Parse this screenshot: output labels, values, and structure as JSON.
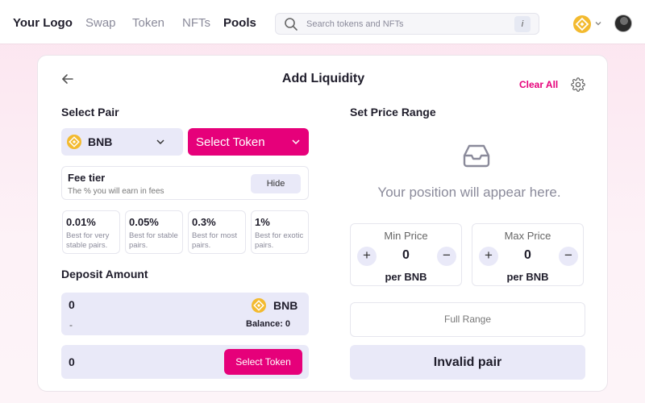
{
  "nav": {
    "logo": "Your Logo",
    "links": [
      {
        "label": "Swap",
        "active": false
      },
      {
        "label": "Token",
        "active": false
      },
      {
        "label": "NFTs",
        "active": false
      },
      {
        "label": "Pools",
        "active": true
      }
    ],
    "search_placeholder": "Search tokens and NFTs",
    "search_info": "i",
    "chain_icon": "bnb-coin-icon",
    "avatar_icon": "avatar"
  },
  "card": {
    "title": "Add Liquidity",
    "clear_all": "Clear All",
    "select_pair_label": "Select Pair",
    "token_a": "BNB",
    "select_token_label": "Select Token",
    "fee": {
      "title": "Fee tier",
      "subtitle": "The % you will earn in fees",
      "hide_label": "Hide",
      "tiers": [
        {
          "pct": "0.01%",
          "desc": "Best for very stable pairs."
        },
        {
          "pct": "0.05%",
          "desc": "Best for stable pairs."
        },
        {
          "pct": "0.3%",
          "desc": "Best for most pairs."
        },
        {
          "pct": "1%",
          "desc": "Best for exotic pairs."
        }
      ]
    },
    "deposit": {
      "label": "Deposit Amount",
      "first": {
        "amount": "0",
        "usd": "-",
        "token": "BNB",
        "balance": "Balance: 0"
      },
      "second": {
        "amount": "0",
        "select_label": "Select Token"
      }
    },
    "price_range": {
      "label": "Set Price Range",
      "empty_text": "Your position will appear here.",
      "min": {
        "label": "Min Price",
        "value": "0",
        "unit": "per BNB"
      },
      "max": {
        "label": "Max Price",
        "value": "0",
        "unit": "per BNB"
      },
      "full_range": "Full Range",
      "action": "Invalid pair"
    }
  },
  "colors": {
    "accent": "#e6007a",
    "muted_bg": "#e9e9f8",
    "bnb": "#f3ba2f"
  }
}
